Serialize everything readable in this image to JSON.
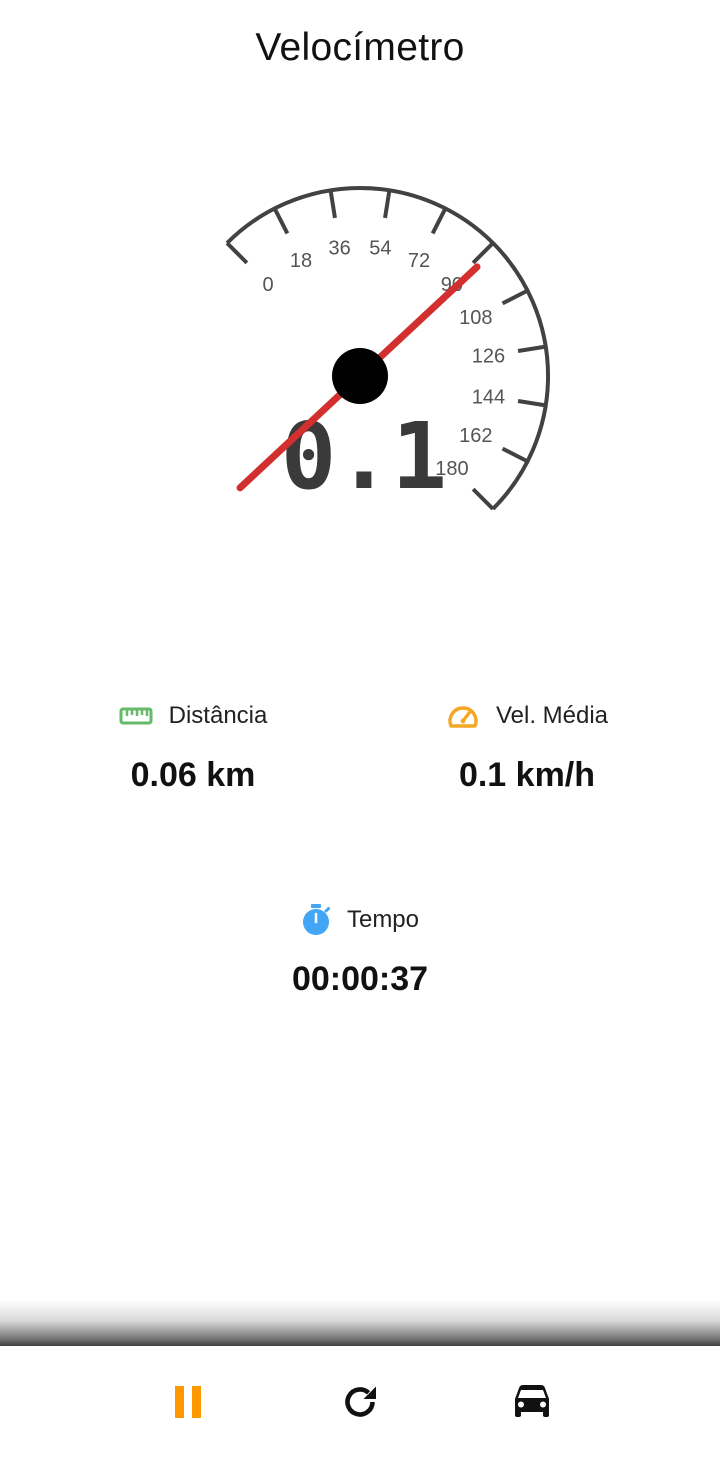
{
  "header": {
    "title": "Velocímetro"
  },
  "speedometer": {
    "current_speed_display": "0.1",
    "current_speed": 0.1,
    "scale_labels": [
      "0",
      "18",
      "36",
      "54",
      "72",
      "90",
      "108",
      "126",
      "144",
      "162",
      "180"
    ],
    "needle_color": "#d32f2f",
    "dial_color": "#424242",
    "hub_color": "#000000"
  },
  "stats": {
    "distance": {
      "label": "Distância",
      "value": "0.06 km",
      "icon": "ruler-icon",
      "icon_color": "#66bb6a"
    },
    "avg_speed": {
      "label": "Vel. Média",
      "value": "0.1 km/h",
      "icon": "speed-gauge-icon",
      "icon_color": "#f5a623"
    },
    "time": {
      "label": "Tempo",
      "value": "00:00:37",
      "icon": "stopwatch-icon",
      "icon_color": "#42a5f5"
    }
  },
  "bottom_nav": {
    "pause": {
      "icon": "pause-icon",
      "color": "#ff9800"
    },
    "reset": {
      "icon": "refresh-icon",
      "color": "#111111"
    },
    "vehicle": {
      "icon": "car-icon",
      "color": "#111111"
    }
  }
}
